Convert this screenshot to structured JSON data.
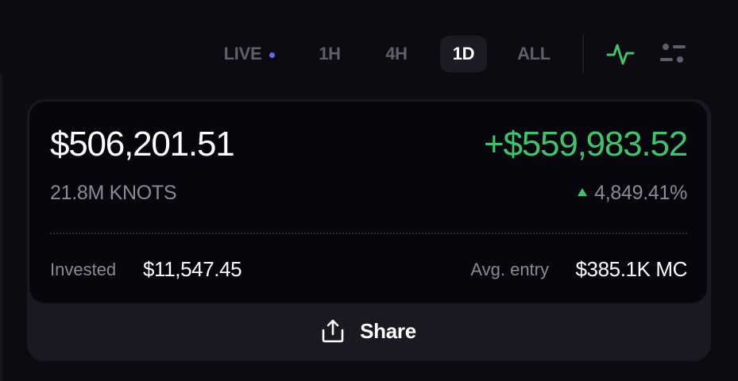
{
  "timeframes": {
    "live": "LIVE",
    "h1": "1H",
    "h4": "4H",
    "d1": "1D",
    "all": "ALL",
    "selected": "1D"
  },
  "icons": {
    "chart_toggle": "activity-icon",
    "settings": "sliders-icon"
  },
  "colors": {
    "gain": "#3ec46d",
    "live_dot": "#5b6cf0",
    "muted": "#8a8996"
  },
  "position": {
    "value": "$506,201.51",
    "pnl": "+$559,983.52",
    "quantity": "21.8M KNOTS",
    "change_pct": "4,849.41%",
    "invested_label": "Invested",
    "invested_value": "$11,547.45",
    "avg_entry_label": "Avg. entry",
    "avg_entry_value": "$385.1K MC"
  },
  "share": {
    "label": "Share"
  }
}
